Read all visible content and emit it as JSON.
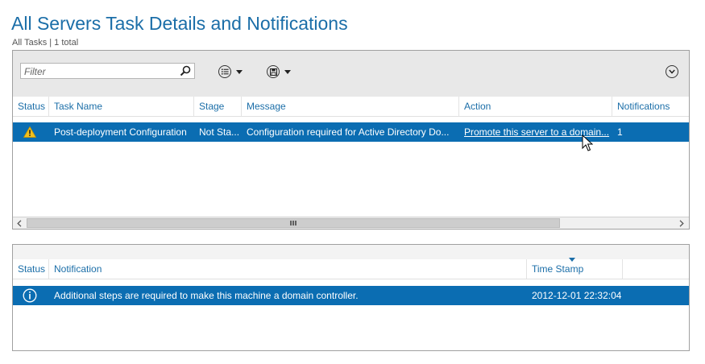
{
  "page": {
    "title": "All Servers Task Details and Notifications",
    "subtitle": "All Tasks | 1 total"
  },
  "tasks_panel": {
    "filter_placeholder": "Filter",
    "columns": {
      "status": "Status",
      "task_name": "Task Name",
      "stage": "Stage",
      "message": "Message",
      "action": "Action",
      "notifications": "Notifications"
    },
    "rows": [
      {
        "status_icon": "warning-icon",
        "task_name": "Post-deployment Configuration",
        "stage": "Not Sta...",
        "message": "Configuration required for Active Directory Do...",
        "action": "Promote this server to a domain...",
        "notifications": "1"
      }
    ],
    "scrollbar_grip": "III"
  },
  "notifications_panel": {
    "columns": {
      "status": "Status",
      "notification": "Notification",
      "time_stamp": "Time Stamp"
    },
    "rows": [
      {
        "status_icon": "info-icon",
        "notification": "Additional steps are required to make this machine a domain controller.",
        "time_stamp": "2012-12-01 22:32:04"
      }
    ]
  },
  "colors": {
    "accent": "#1b6ea8",
    "selection": "#0b6db2",
    "toolbar_bg": "#e8e8e8",
    "warning": "#f2c01e"
  }
}
